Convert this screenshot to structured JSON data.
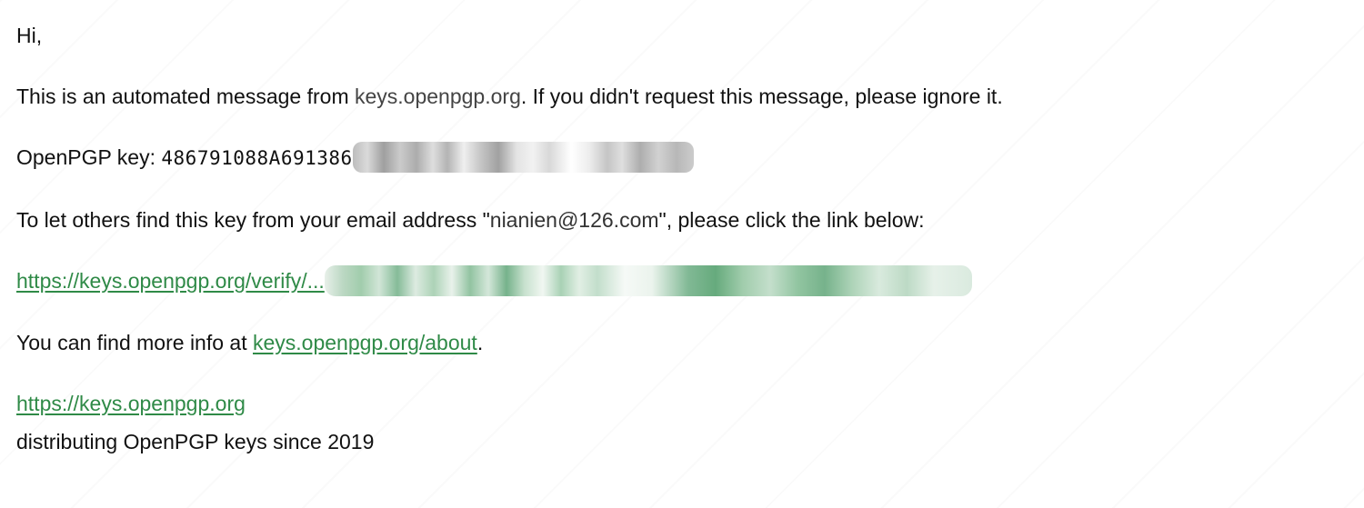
{
  "email": {
    "greeting": "Hi,",
    "intro": {
      "before": "This is an automated message from ",
      "domain": "keys.openpgp.org",
      "after": ". If you didn't request this message, please ignore it."
    },
    "key": {
      "label": "OpenPGP key: ",
      "fingerprint_visible": "486791088A691386"
    },
    "let_others": {
      "before": "To let others find this key from your email address \"",
      "email": "nianien@126.com",
      "after": "\", please click the link below:"
    },
    "verify_link": {
      "visible_prefix": "https://keys.openpgp.org/verify/..."
    },
    "more_info": {
      "before": "You can find more info at ",
      "link": "keys.openpgp.org/about",
      "after": "."
    },
    "footer": {
      "link": "https://keys.openpgp.org",
      "tagline": "distributing OpenPGP keys since 2019"
    }
  },
  "colors": {
    "link": "#2f8a47",
    "text": "#111111",
    "muted_domain": "#444444"
  }
}
